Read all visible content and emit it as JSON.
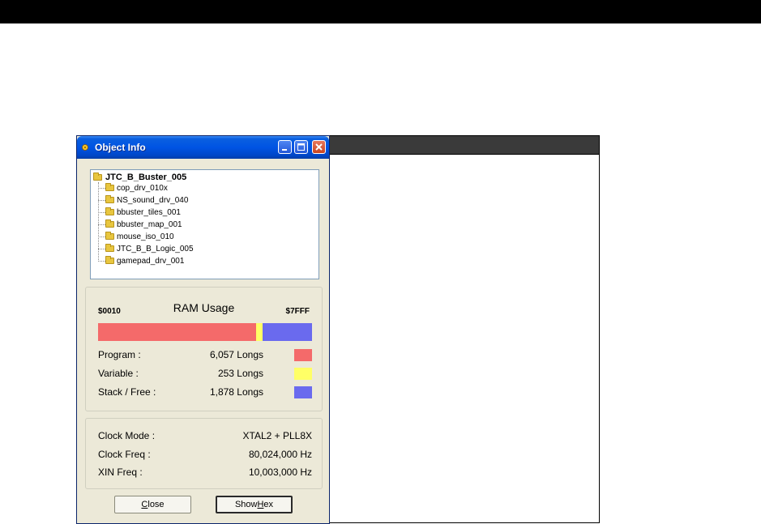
{
  "window": {
    "title": "Object Info"
  },
  "tree": {
    "root": "JTC_B_Buster_005",
    "children": [
      "cop_drv_010x",
      "NS_sound_drv_040",
      "bbuster_tiles_001",
      "bbuster_map_001",
      "mouse_iso_010",
      "JTC_B_B_Logic_005",
      "gamepad_drv_001"
    ]
  },
  "ram": {
    "title": "RAM Usage",
    "low": "$0010",
    "high": "$7FFF",
    "rows": [
      {
        "label": "Program :",
        "value": "6,057 Longs",
        "color": "#f46a6a",
        "longs": 6057
      },
      {
        "label": "Variable :",
        "value": "253 Longs",
        "color": "#ffff66",
        "longs": 253
      },
      {
        "label": "Stack / Free :",
        "value": "1,878 Longs",
        "color": "#6a6aee",
        "longs": 1878
      }
    ]
  },
  "clock": {
    "rows": [
      {
        "label": "Clock Mode :",
        "value": "XTAL2 + PLL8X"
      },
      {
        "label": "Clock Freq :",
        "value": "80,024,000 Hz"
      },
      {
        "label": "XIN Freq :",
        "value": "10,003,000 Hz"
      }
    ]
  },
  "buttons": {
    "close": {
      "pre": "",
      "accel": "C",
      "post": "lose"
    },
    "hex": {
      "pre": "Show ",
      "accel": "H",
      "post": "ex"
    }
  }
}
